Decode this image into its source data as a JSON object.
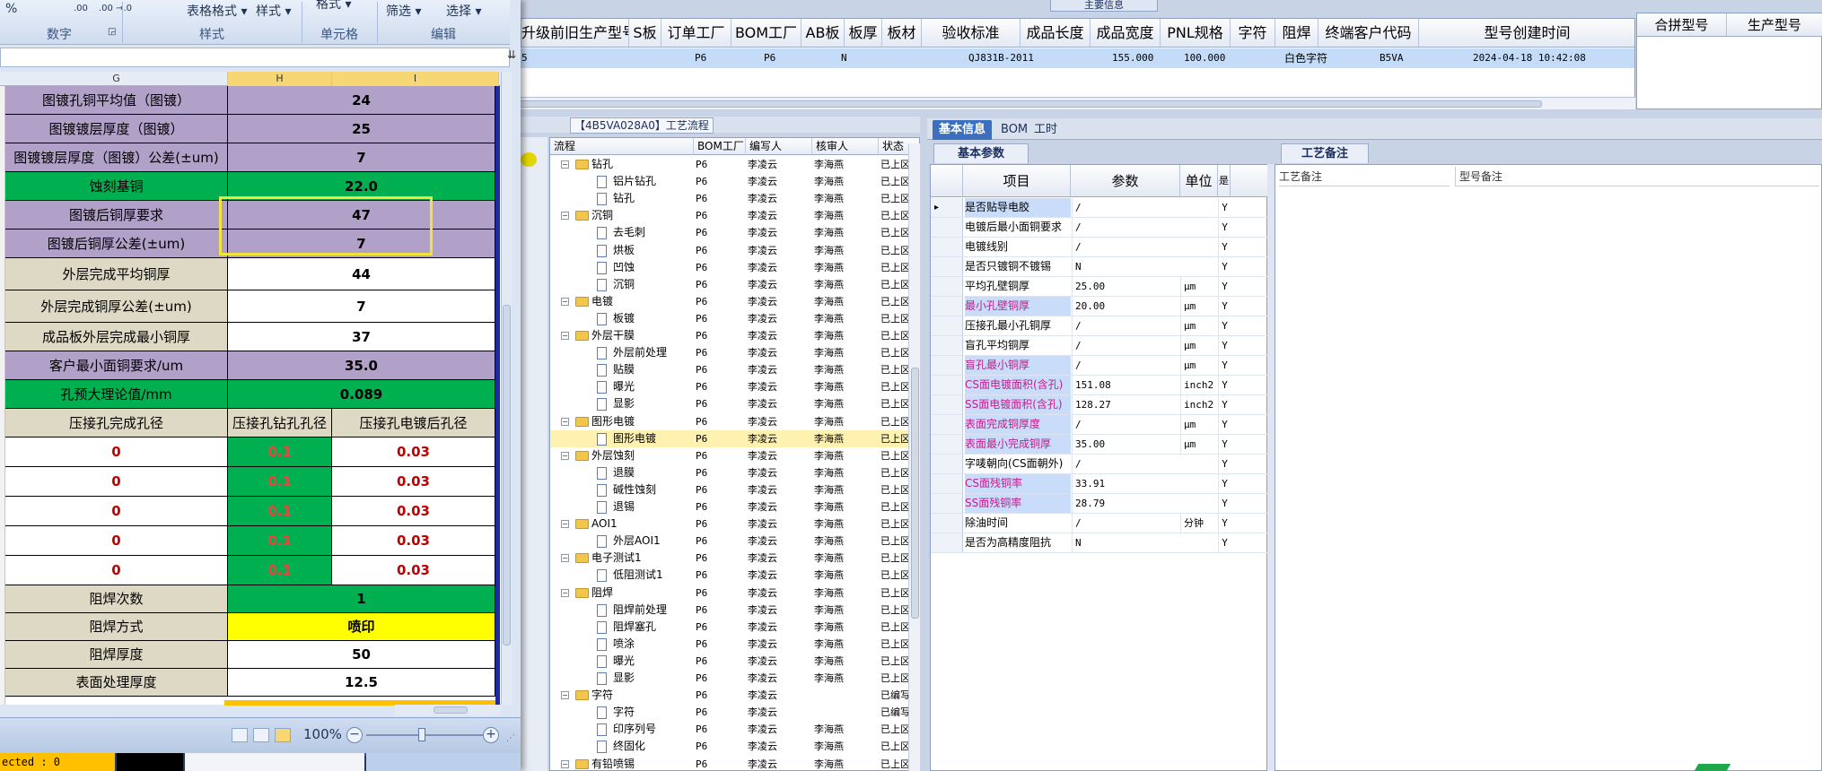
{
  "main_grid": {
    "caption": "主要信息",
    "headers": [
      "升级前旧生产型号",
      "S板",
      "订单工厂",
      "BOM工厂",
      "AB板",
      "板厚",
      "板材",
      "验收标准",
      "成品长度",
      "成品宽度",
      "PNL规格",
      "字符",
      "阻焊",
      "终端客户代码",
      "型号创建时间"
    ],
    "row": {
      "left_stub": "5",
      "order_factory": "P6",
      "bom_factory": "P6",
      "ab_board": "N",
      "acceptance": "QJ831B-2011",
      "length": "155.000",
      "width": "100.000",
      "char": "白色字符",
      "customer_code": "B5VA",
      "created": "2024-04-18 10:42:08"
    },
    "merge_headers": [
      "合拼型号",
      "生产型号"
    ]
  },
  "process": {
    "title": "【4B5VA028A0】工艺流程",
    "headers": [
      "流程",
      "BOM工厂",
      "编写人",
      "核审人",
      "状态"
    ],
    "rows": [
      {
        "name": "钻孔",
        "level": 1,
        "folder": true,
        "bom": "P6",
        "writer": "李凌云",
        "reviewer": "李海燕",
        "status": "已上区"
      },
      {
        "name": "铝片钻孔",
        "level": 2,
        "folder": false,
        "bom": "P6",
        "writer": "李凌云",
        "reviewer": "李海燕",
        "status": "已上区"
      },
      {
        "name": "钻孔",
        "level": 2,
        "folder": false,
        "bom": "P6",
        "writer": "李凌云",
        "reviewer": "李海燕",
        "status": "已上区"
      },
      {
        "name": "沉铜",
        "level": 1,
        "folder": true,
        "bom": "P6",
        "writer": "李凌云",
        "reviewer": "李海燕",
        "status": "已上区"
      },
      {
        "name": "去毛刺",
        "level": 2,
        "folder": false,
        "bom": "P6",
        "writer": "李凌云",
        "reviewer": "李海燕",
        "status": "已上区"
      },
      {
        "name": "烘板",
        "level": 2,
        "folder": false,
        "bom": "P6",
        "writer": "李凌云",
        "reviewer": "李海燕",
        "status": "已上区"
      },
      {
        "name": "凹蚀",
        "level": 2,
        "folder": false,
        "bom": "P6",
        "writer": "李凌云",
        "reviewer": "李海燕",
        "status": "已上区"
      },
      {
        "name": "沉铜",
        "level": 2,
        "folder": false,
        "bom": "P6",
        "writer": "李凌云",
        "reviewer": "李海燕",
        "status": "已上区"
      },
      {
        "name": "电镀",
        "level": 1,
        "folder": true,
        "bom": "P6",
        "writer": "李凌云",
        "reviewer": "李海燕",
        "status": "已上区"
      },
      {
        "name": "板镀",
        "level": 2,
        "folder": false,
        "bom": "P6",
        "writer": "李凌云",
        "reviewer": "李海燕",
        "status": "已上区"
      },
      {
        "name": "外层干膜",
        "level": 1,
        "folder": true,
        "bom": "P6",
        "writer": "李凌云",
        "reviewer": "李海燕",
        "status": "已上区"
      },
      {
        "name": "外层前处理",
        "level": 2,
        "folder": false,
        "bom": "P6",
        "writer": "李凌云",
        "reviewer": "李海燕",
        "status": "已上区"
      },
      {
        "name": "贴膜",
        "level": 2,
        "folder": false,
        "bom": "P6",
        "writer": "李凌云",
        "reviewer": "李海燕",
        "status": "已上区"
      },
      {
        "name": "曝光",
        "level": 2,
        "folder": false,
        "bom": "P6",
        "writer": "李凌云",
        "reviewer": "李海燕",
        "status": "已上区"
      },
      {
        "name": "显影",
        "level": 2,
        "folder": false,
        "bom": "P6",
        "writer": "李凌云",
        "reviewer": "李海燕",
        "status": "已上区"
      },
      {
        "name": "图形电镀",
        "level": 1,
        "folder": true,
        "bom": "P6",
        "writer": "李凌云",
        "reviewer": "李海燕",
        "status": "已上区"
      },
      {
        "name": "图形电镀",
        "level": 2,
        "folder": false,
        "bom": "P6",
        "writer": "李凌云",
        "reviewer": "李海燕",
        "status": "已上区",
        "selected": true
      },
      {
        "name": "外层蚀刻",
        "level": 1,
        "folder": true,
        "bom": "P6",
        "writer": "李凌云",
        "reviewer": "李海燕",
        "status": "已上区"
      },
      {
        "name": "退膜",
        "level": 2,
        "folder": false,
        "bom": "P6",
        "writer": "李凌云",
        "reviewer": "李海燕",
        "status": "已上区"
      },
      {
        "name": "碱性蚀刻",
        "level": 2,
        "folder": false,
        "bom": "P6",
        "writer": "李凌云",
        "reviewer": "李海燕",
        "status": "已上区"
      },
      {
        "name": "退锡",
        "level": 2,
        "folder": false,
        "bom": "P6",
        "writer": "李凌云",
        "reviewer": "李海燕",
        "status": "已上区"
      },
      {
        "name": "AOI1",
        "level": 1,
        "folder": true,
        "bom": "P6",
        "writer": "李凌云",
        "reviewer": "李海燕",
        "status": "已上区"
      },
      {
        "name": "外层AOI1",
        "level": 2,
        "folder": false,
        "bom": "P6",
        "writer": "李凌云",
        "reviewer": "李海燕",
        "status": "已上区"
      },
      {
        "name": "电子测试1",
        "level": 1,
        "folder": true,
        "bom": "P6",
        "writer": "李凌云",
        "reviewer": "李海燕",
        "status": "已上区"
      },
      {
        "name": "低阻测试1",
        "level": 2,
        "folder": false,
        "bom": "P6",
        "writer": "李凌云",
        "reviewer": "李海燕",
        "status": "已上区"
      },
      {
        "name": "阻焊",
        "level": 1,
        "folder": true,
        "bom": "P6",
        "writer": "李凌云",
        "reviewer": "李海燕",
        "status": "已上区"
      },
      {
        "name": "阻焊前处理",
        "level": 2,
        "folder": false,
        "bom": "P6",
        "writer": "李凌云",
        "reviewer": "李海燕",
        "status": "已上区"
      },
      {
        "name": "阻焊塞孔",
        "level": 2,
        "folder": false,
        "bom": "P6",
        "writer": "李凌云",
        "reviewer": "李海燕",
        "status": "已上区"
      },
      {
        "name": "喷涂",
        "level": 2,
        "folder": false,
        "bom": "P6",
        "writer": "李凌云",
        "reviewer": "李海燕",
        "status": "已上区"
      },
      {
        "name": "曝光",
        "level": 2,
        "folder": false,
        "bom": "P6",
        "writer": "李凌云",
        "reviewer": "李海燕",
        "status": "已上区"
      },
      {
        "name": "显影",
        "level": 2,
        "folder": false,
        "bom": "P6",
        "writer": "李凌云",
        "reviewer": "李海燕",
        "status": "已上区"
      },
      {
        "name": "字符",
        "level": 1,
        "folder": true,
        "bom": "P6",
        "writer": "李凌云",
        "reviewer": "",
        "status": "已编写"
      },
      {
        "name": "字符",
        "level": 2,
        "folder": false,
        "bom": "P6",
        "writer": "李凌云",
        "reviewer": "",
        "status": "已编写"
      },
      {
        "name": "印序列号",
        "level": 2,
        "folder": false,
        "bom": "P6",
        "writer": "李凌云",
        "reviewer": "李海燕",
        "status": "已上区"
      },
      {
        "name": "终固化",
        "level": 2,
        "folder": false,
        "bom": "P6",
        "writer": "李凌云",
        "reviewer": "李海燕",
        "status": "已上区"
      },
      {
        "name": "有铅喷锡",
        "level": 1,
        "folder": true,
        "bom": "P6",
        "writer": "李凌云",
        "reviewer": "李海燕",
        "status": "已上区"
      }
    ]
  },
  "basic_info": {
    "tabs": [
      "基本信息",
      "BOM",
      "工时"
    ],
    "subtab": "基本参数",
    "headers": [
      "项目",
      "参数",
      "单位",
      "是"
    ],
    "rows": [
      {
        "k": "是否贴导电胶",
        "v": "/",
        "u": "",
        "f": "Y",
        "hl": true,
        "red": false,
        "current": true
      },
      {
        "k": "电镀后最小面铜要求",
        "v": "/",
        "u": "",
        "f": "Y",
        "hl": false,
        "red": false
      },
      {
        "k": "电镀线别",
        "v": "/",
        "u": "",
        "f": "Y",
        "hl": false,
        "red": false
      },
      {
        "k": "是否只镀铜不镀锡",
        "v": "N",
        "u": "",
        "f": "Y",
        "hl": false,
        "red": false
      },
      {
        "k": "平均孔壁铜厚",
        "v": "25.00",
        "u": "μm",
        "f": "Y",
        "hl": false,
        "red": false
      },
      {
        "k": "最小孔壁铜厚",
        "v": "20.00",
        "u": "μm",
        "f": "Y",
        "hl": true,
        "red": true
      },
      {
        "k": "压接孔最小孔铜厚",
        "v": "/",
        "u": "μm",
        "f": "Y",
        "hl": false,
        "red": false
      },
      {
        "k": "盲孔平均铜厚",
        "v": "/",
        "u": "μm",
        "f": "Y",
        "hl": false,
        "red": false
      },
      {
        "k": "盲孔最小铜厚",
        "v": "/",
        "u": "μm",
        "f": "Y",
        "hl": true,
        "red": true
      },
      {
        "k": "CS面电镀面积(含孔)",
        "v": "151.08",
        "u": "inch2",
        "f": "Y",
        "hl": true,
        "red": true
      },
      {
        "k": "SS面电镀面积(含孔)",
        "v": "128.27",
        "u": "inch2",
        "f": "Y",
        "hl": true,
        "red": true
      },
      {
        "k": "表面完成铜厚度",
        "v": "/",
        "u": "μm",
        "f": "Y",
        "hl": true,
        "red": true
      },
      {
        "k": "表面最小完成铜厚",
        "v": "35.00",
        "u": "μm",
        "f": "Y",
        "hl": true,
        "red": true
      },
      {
        "k": "字唛朝向(CS面朝外)",
        "v": "/",
        "u": "",
        "f": "Y",
        "hl": false,
        "red": false
      },
      {
        "k": "CS面残铜率",
        "v": "33.91",
        "u": "",
        "f": "Y",
        "hl": true,
        "red": true
      },
      {
        "k": "SS面残铜率",
        "v": "28.79",
        "u": "",
        "f": "Y",
        "hl": true,
        "red": true
      },
      {
        "k": "除油时间",
        "v": "/",
        "u": "分钟",
        "f": "Y",
        "hl": false,
        "red": false
      },
      {
        "k": "是否为高精度阻抗",
        "v": "N",
        "u": "",
        "f": "Y",
        "hl": false,
        "red": false
      }
    ],
    "process_notes": {
      "subtab": "工艺备注",
      "col1": "工艺备注",
      "col2": "型号备注"
    }
  },
  "excel": {
    "ribbon": {
      "buttons": [
        "%",
        "表格格式 ▾",
        "样式 ▾",
        "格式 ▾",
        "筛选 ▾",
        "选择 ▾"
      ],
      "small_buttons": [
        ".00",
        ".00 →.0"
      ],
      "groups": [
        "数字",
        "样式",
        "单元格",
        "编辑"
      ]
    },
    "columns": [
      "G",
      "H",
      "I"
    ],
    "rows": [
      {
        "label": "图镀孔铜平均值（图镀）",
        "value": "24",
        "fill": "purple"
      },
      {
        "label": "图镀镀层厚度（图镀）",
        "value": "25",
        "fill": "purple"
      },
      {
        "label": "图镀镀层厚度（图镀）公差(±um)",
        "value": "7",
        "fill": "purple"
      },
      {
        "label": "蚀刻基铜",
        "value": "22.0",
        "fill": "green"
      },
      {
        "label": "图镀后铜厚要求",
        "value": "47",
        "fill": "purple"
      },
      {
        "label": "图镀后铜厚公差(±um)",
        "value": "7",
        "fill": "purple"
      },
      {
        "label": "外层完成平均铜厚",
        "value": "44",
        "fill": "grayb"
      },
      {
        "label": "外层完成铜厚公差(±um)",
        "value": "7",
        "fill": "grayb"
      },
      {
        "label": "成品板外层完成最小铜厚",
        "value": "37",
        "fill": "grayb"
      },
      {
        "label": "客户最小面铜要求/um",
        "value": "35.0",
        "fill": "purple"
      },
      {
        "label": "孔预大理论值/mm",
        "value": "0.089",
        "fill": "green"
      }
    ],
    "press_headers": [
      "压接孔完成孔径",
      "压接孔钻孔孔径",
      "压接孔电镀后孔径"
    ],
    "press_rows": [
      [
        "0",
        "0.1",
        "0.03"
      ],
      [
        "0",
        "0.1",
        "0.03"
      ],
      [
        "0",
        "0.1",
        "0.03"
      ],
      [
        "0",
        "0.1",
        "0.03"
      ],
      [
        "0",
        "0.1",
        "0.03"
      ]
    ],
    "bottom_rows": [
      {
        "label": "阻焊次数",
        "value": "1",
        "fill": "green"
      },
      {
        "label": "阻焊方式",
        "value": "喷印",
        "fill": "yellow"
      },
      {
        "label": "阻焊厚度",
        "value": "50",
        "fill": "white"
      },
      {
        "label": "表面处理厚度",
        "value": "12.5",
        "fill": "white"
      }
    ],
    "zoom": "100%",
    "status_selected": "ected : 0"
  }
}
